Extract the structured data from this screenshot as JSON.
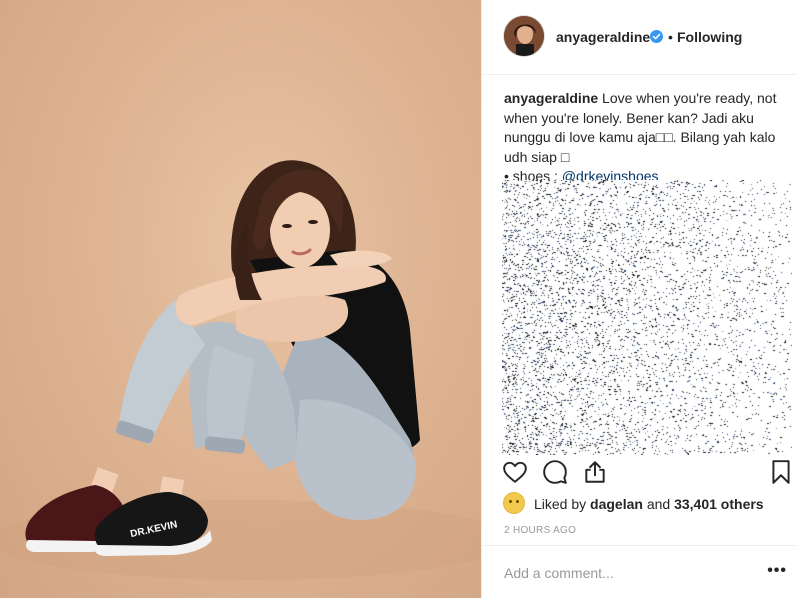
{
  "post": {
    "username": "anyageraldine",
    "follow_separator": "•",
    "follow_status": "Following",
    "caption_user": "anyageraldine",
    "caption_text": "Love when you're ready, not when you're lonely. Bener kan? Jadi aku nunggu di love kamu aja□□. Bilang yah kalo udh siap □",
    "caption_line2_prefix": "• shoes : ",
    "caption_mention": "@drkevinshoes",
    "likes_prefix": "Liked by",
    "likes_user": "dagelan",
    "likes_and": "and",
    "likes_count": "33,401 others",
    "timestamp": "2 HOURS AGO",
    "comment_placeholder": "Add a comment...",
    "more_label": "•••"
  },
  "photo": {
    "shoe_brand": "DR.KEVIN"
  },
  "icons": {
    "like": "heart-icon",
    "comment": "comment-icon",
    "share": "share-icon",
    "save": "bookmark-icon",
    "verified": "verified-badge-icon"
  },
  "colors": {
    "link": "#003569",
    "verified": "#3897f0",
    "muted": "#999999",
    "text": "#262626"
  }
}
